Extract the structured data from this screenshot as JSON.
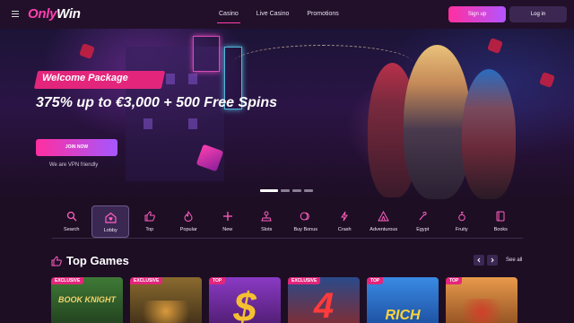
{
  "brand": {
    "logo_prefix": "Only",
    "logo_suffix": "Win"
  },
  "nav": [
    {
      "label": "Casino",
      "active": true
    },
    {
      "label": "Live Casino",
      "active": false
    },
    {
      "label": "Promotions",
      "active": false
    }
  ],
  "auth": {
    "signup_label": "Sign up",
    "login_label": "Log in"
  },
  "hero": {
    "badge": "Welcome Package",
    "headline": "375% up to €3,000 + 500 Free Spins",
    "cta": "JOIN NOW",
    "note": "We are VPN friendly",
    "slides": 4,
    "active_slide": 1
  },
  "categories": [
    {
      "label": "Search",
      "icon": "search-icon",
      "active": false
    },
    {
      "label": "Lobby",
      "icon": "lobby-icon",
      "active": true
    },
    {
      "label": "Top",
      "icon": "thumbs-up-icon",
      "active": false
    },
    {
      "label": "Popular",
      "icon": "flame-icon",
      "active": false
    },
    {
      "label": "New",
      "icon": "plus-icon",
      "active": false
    },
    {
      "label": "Slots",
      "icon": "joystick-icon",
      "active": false
    },
    {
      "label": "Buy Bonus",
      "icon": "coins-icon",
      "active": false
    },
    {
      "label": "Crash",
      "icon": "lightning-icon",
      "active": false
    },
    {
      "label": "Adventurous",
      "icon": "tent-icon",
      "active": false
    },
    {
      "label": "Egypt",
      "icon": "ankh-icon",
      "active": false
    },
    {
      "label": "Fruity",
      "icon": "cherry-icon",
      "active": false
    },
    {
      "label": "Books",
      "icon": "book-icon",
      "active": false
    }
  ],
  "top_games": {
    "title": "Top Games",
    "see_all": "See all",
    "games": [
      {
        "tag": "EXCLUSIVE",
        "art": "BOOK KNIGHT",
        "bg": "#2f5a2b"
      },
      {
        "tag": "EXCLUSIVE",
        "art": "",
        "bg": "#6a4a1e"
      },
      {
        "tag": "TOP",
        "art": "$",
        "bg": "#6b2b9e"
      },
      {
        "tag": "EXCLUSIVE",
        "art": "4",
        "bg": "#7a2d2d"
      },
      {
        "tag": "TOP",
        "art": "RICH",
        "bg": "#2a6ec4"
      },
      {
        "tag": "TOP",
        "art": "",
        "bg": "#c7722c"
      }
    ]
  },
  "colors": {
    "accent": "#ff3fae",
    "background": "#1d0e24",
    "header": "#22102a"
  }
}
